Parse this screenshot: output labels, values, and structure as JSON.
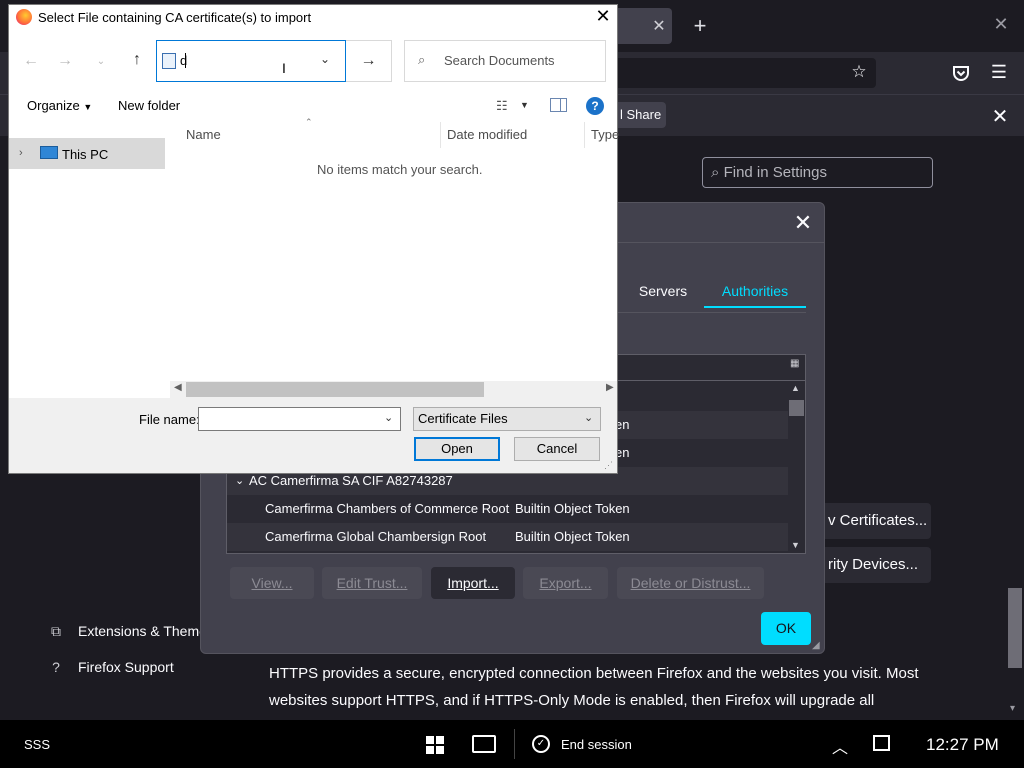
{
  "firefox": {
    "share_label": "l Share",
    "find_placeholder": "Find in Settings",
    "sidebar": [
      {
        "label": "Extensions & Themes",
        "icon": "puzzle-icon"
      },
      {
        "label": "Firefox Support",
        "icon": "help-circle-icon"
      }
    ],
    "https_text_1": "HTTPS provides a secure, encrypted connection between Firefox and the websites you visit. Most",
    "https_text_2": "websites support HTTPS, and if HTTPS-Only Mode is enabled, then Firefox will upgrade all",
    "view_certs_label": "v Certificates...",
    "security_devices_label": "rity Devices..."
  },
  "cert_manager": {
    "tabs": [
      {
        "label": "Servers",
        "active": false
      },
      {
        "label": "Authorities",
        "active": true
      }
    ],
    "rows": [
      {
        "name": "",
        "device": "en"
      },
      {
        "name": "",
        "device": "en"
      },
      {
        "name": "AC Camerfirma SA CIF A82743287",
        "device": "",
        "group": true
      },
      {
        "name": "Camerfirma Chambers of Commerce Root",
        "device": "Builtin Object Token"
      },
      {
        "name": "Camerfirma Global Chambersign Root",
        "device": "Builtin Object Token"
      }
    ],
    "buttons": {
      "view": "View...",
      "edit_trust": "Edit Trust...",
      "import": "Import...",
      "export": "Export...",
      "delete": "Delete or Distrust...",
      "ok": "OK"
    },
    "accent": "#00ddff"
  },
  "file_dialog": {
    "title": "Select File containing CA certificate(s) to import",
    "path_value": "d",
    "search_placeholder": "Search Documents",
    "toolbar": {
      "organize": "Organize",
      "new_folder": "New folder"
    },
    "nav": {
      "this_pc": "This PC"
    },
    "columns": [
      "Name",
      "Date modified",
      "Type"
    ],
    "empty_message": "No items match your search.",
    "file_name_label": "File name:",
    "file_name_value": "",
    "file_type": "Certificate Files",
    "open_label": "Open",
    "cancel_label": "Cancel"
  },
  "taskbar": {
    "user": "SSS",
    "end_session": "End session",
    "clock": "12:27 PM"
  }
}
